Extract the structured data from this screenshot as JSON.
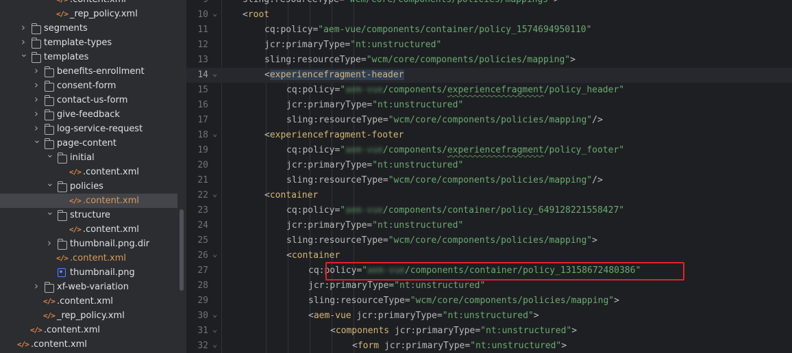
{
  "file_tree": [
    {
      "label": ".content.xml",
      "type": "xml",
      "depth": 3,
      "arrow": "",
      "orange": false
    },
    {
      "label": "_rep_policy.xml",
      "type": "xml",
      "depth": 3,
      "arrow": "",
      "orange": false
    },
    {
      "label": "segments",
      "type": "folder",
      "depth": 1,
      "arrow": "right",
      "orange": false
    },
    {
      "label": "template-types",
      "type": "folder",
      "depth": 1,
      "arrow": "right",
      "orange": false
    },
    {
      "label": "templates",
      "type": "folder",
      "depth": 1,
      "arrow": "down",
      "orange": false
    },
    {
      "label": "benefits-enrollment",
      "type": "folder",
      "depth": 2,
      "arrow": "right",
      "orange": false
    },
    {
      "label": "consent-form",
      "type": "folder",
      "depth": 2,
      "arrow": "right",
      "orange": false
    },
    {
      "label": "contact-us-form",
      "type": "folder",
      "depth": 2,
      "arrow": "right",
      "orange": false
    },
    {
      "label": "give-feedback",
      "type": "folder",
      "depth": 2,
      "arrow": "right",
      "orange": false
    },
    {
      "label": "log-service-request",
      "type": "folder",
      "depth": 2,
      "arrow": "right",
      "orange": false
    },
    {
      "label": "page-content",
      "type": "folder",
      "depth": 2,
      "arrow": "down",
      "orange": false
    },
    {
      "label": "initial",
      "type": "folder",
      "depth": 3,
      "arrow": "down",
      "orange": false
    },
    {
      "label": ".content.xml",
      "type": "xml",
      "depth": 4,
      "arrow": "",
      "orange": false
    },
    {
      "label": "policies",
      "type": "folder",
      "depth": 3,
      "arrow": "down",
      "orange": false
    },
    {
      "label": ".content.xml",
      "type": "xml",
      "depth": 4,
      "arrow": "",
      "orange": true,
      "selected": true
    },
    {
      "label": "structure",
      "type": "folder",
      "depth": 3,
      "arrow": "down",
      "orange": false
    },
    {
      "label": ".content.xml",
      "type": "xml",
      "depth": 4,
      "arrow": "",
      "orange": false
    },
    {
      "label": "thumbnail.png.dir",
      "type": "folder",
      "depth": 3,
      "arrow": "right",
      "orange": false
    },
    {
      "label": ".content.xml",
      "type": "xml",
      "depth": 3,
      "arrow": "",
      "orange": true
    },
    {
      "label": "thumbnail.png",
      "type": "image",
      "depth": 3,
      "arrow": "",
      "orange": false
    },
    {
      "label": "xf-web-variation",
      "type": "folder",
      "depth": 2,
      "arrow": "right",
      "orange": false
    },
    {
      "label": ".content.xml",
      "type": "xml",
      "depth": 2,
      "arrow": "",
      "orange": false
    },
    {
      "label": "_rep_policy.xml",
      "type": "xml",
      "depth": 2,
      "arrow": "",
      "orange": false
    },
    {
      "label": ".content.xml",
      "type": "xml",
      "depth": 1,
      "arrow": "",
      "orange": false
    },
    {
      "label": ".content.xml",
      "type": "xml",
      "depth": 0,
      "arrow": "",
      "orange": false
    }
  ],
  "editor": {
    "lines": [
      {
        "n": "9",
        "indent": 2,
        "fold": "",
        "parts": [
          [
            "a",
            "sling:resourceType="
          ],
          [
            "v",
            "\"wcm/core/components/policies/mappings\""
          ],
          [
            "p",
            ">"
          ]
        ]
      },
      {
        "n": "10",
        "indent": 2,
        "fold": "open",
        "parts": [
          [
            "p",
            "<"
          ],
          [
            "t",
            "root"
          ]
        ]
      },
      {
        "n": "11",
        "indent": 3,
        "fold": "",
        "parts": [
          [
            "a",
            "cq:policy="
          ],
          [
            "v",
            "\"aem-vue/components/container/policy_1574694950110\""
          ]
        ]
      },
      {
        "n": "12",
        "indent": 3,
        "fold": "",
        "parts": [
          [
            "a",
            "jcr:primaryType="
          ],
          [
            "v",
            "\"nt:unstructured\""
          ]
        ]
      },
      {
        "n": "13",
        "indent": 3,
        "fold": "",
        "parts": [
          [
            "a",
            "sling:resourceType="
          ],
          [
            "v",
            "\"wcm/core/components/policies/mapping\""
          ],
          [
            "p",
            ">"
          ]
        ]
      },
      {
        "n": "14",
        "indent": 3,
        "fold": "open",
        "current": true,
        "parts": [
          [
            "p",
            "<"
          ],
          [
            "th",
            "experiencefragment-header"
          ]
        ]
      },
      {
        "n": "15",
        "indent": 4,
        "fold": "",
        "parts": [
          [
            "a",
            "cq:policy="
          ],
          [
            "v",
            "\""
          ],
          [
            "vb",
            "aem-vue"
          ],
          [
            "v",
            "/components/"
          ],
          [
            "vs",
            "experiencefragment"
          ],
          [
            "v",
            "/policy_header\""
          ]
        ]
      },
      {
        "n": "16",
        "indent": 4,
        "fold": "",
        "parts": [
          [
            "a",
            "jcr:primaryType="
          ],
          [
            "v",
            "\"nt:unstructured\""
          ]
        ]
      },
      {
        "n": "17",
        "indent": 4,
        "fold": "",
        "parts": [
          [
            "a",
            "sling:resourceType="
          ],
          [
            "v",
            "\"wcm/core/components/policies/mapping\""
          ],
          [
            "p",
            "/>"
          ]
        ]
      },
      {
        "n": "18",
        "indent": 3,
        "fold": "open",
        "parts": [
          [
            "p",
            "<"
          ],
          [
            "t",
            "experiencefragment-footer"
          ]
        ]
      },
      {
        "n": "19",
        "indent": 4,
        "fold": "",
        "parts": [
          [
            "a",
            "cq:policy="
          ],
          [
            "v",
            "\""
          ],
          [
            "vb",
            "aem-vue"
          ],
          [
            "v",
            "/components/"
          ],
          [
            "vs",
            "experiencefragment"
          ],
          [
            "v",
            "/policy_footer\""
          ]
        ]
      },
      {
        "n": "20",
        "indent": 4,
        "fold": "",
        "parts": [
          [
            "a",
            "jcr:primaryType="
          ],
          [
            "v",
            "\"nt:unstructured\""
          ]
        ]
      },
      {
        "n": "21",
        "indent": 4,
        "fold": "",
        "parts": [
          [
            "a",
            "sling:resourceType="
          ],
          [
            "v",
            "\"wcm/core/components/policies/mapping\""
          ],
          [
            "p",
            "/>"
          ]
        ]
      },
      {
        "n": "22",
        "indent": 3,
        "fold": "open",
        "parts": [
          [
            "p",
            "<"
          ],
          [
            "t",
            "container"
          ]
        ]
      },
      {
        "n": "23",
        "indent": 4,
        "fold": "",
        "parts": [
          [
            "a",
            "cq:policy="
          ],
          [
            "v",
            "\""
          ],
          [
            "vb",
            "aem-vue"
          ],
          [
            "v",
            "/components/container/policy_649128221558427\""
          ]
        ]
      },
      {
        "n": "24",
        "indent": 4,
        "fold": "",
        "parts": [
          [
            "a",
            "jcr:primaryType="
          ],
          [
            "v",
            "\"nt:unstructured\""
          ]
        ]
      },
      {
        "n": "25",
        "indent": 4,
        "fold": "",
        "parts": [
          [
            "a",
            "sling:resourceType="
          ],
          [
            "v",
            "\"wcm/core/components/policies/mapping\""
          ],
          [
            "p",
            ">"
          ]
        ]
      },
      {
        "n": "26",
        "indent": 4,
        "fold": "open",
        "parts": [
          [
            "p",
            "<"
          ],
          [
            "t",
            "container"
          ]
        ]
      },
      {
        "n": "27",
        "indent": 5,
        "fold": "",
        "parts": [
          [
            "a",
            "cq:policy="
          ],
          [
            "v",
            "\""
          ],
          [
            "vb",
            "aem-vue"
          ],
          [
            "v",
            "/components/container/policy_13158672480386\""
          ]
        ]
      },
      {
        "n": "28",
        "indent": 5,
        "fold": "",
        "parts": [
          [
            "a",
            "jcr:primaryType="
          ],
          [
            "v",
            "\"nt:unstructured\""
          ]
        ]
      },
      {
        "n": "29",
        "indent": 5,
        "fold": "",
        "parts": [
          [
            "a",
            "sling:resourceType="
          ],
          [
            "v",
            "\"wcm/core/components/policies/mapping\""
          ],
          [
            "p",
            ">"
          ]
        ]
      },
      {
        "n": "30",
        "indent": 5,
        "fold": "open",
        "parts": [
          [
            "p",
            "<"
          ],
          [
            "t",
            "aem-vue"
          ],
          [
            "p",
            " "
          ],
          [
            "a",
            "jcr:primaryType="
          ],
          [
            "v",
            "\"nt:unstructured\""
          ],
          [
            "p",
            ">"
          ]
        ]
      },
      {
        "n": "31",
        "indent": 6,
        "fold": "open",
        "parts": [
          [
            "p",
            "<"
          ],
          [
            "t",
            "components"
          ],
          [
            "p",
            " "
          ],
          [
            "a",
            "jcr:primaryType="
          ],
          [
            "v",
            "\"nt:unstructured\""
          ],
          [
            "p",
            ">"
          ]
        ]
      },
      {
        "n": "32",
        "indent": 7,
        "fold": "open",
        "parts": [
          [
            "p",
            "<"
          ],
          [
            "t",
            "form"
          ],
          [
            "p",
            " "
          ],
          [
            "a",
            "jcr:primaryType="
          ],
          [
            "v",
            "\"nt:unstructured\""
          ],
          [
            "p",
            ">"
          ]
        ]
      }
    ],
    "highlight_line": "27",
    "highlight_color": "#e1232a"
  },
  "colors": {
    "tag": "#d5b778",
    "attr": "#bababa",
    "value": "#6aab73",
    "line_number": "#6f737a",
    "sidebar_bg": "#2b2d30",
    "editor_bg": "#1e1f22"
  }
}
